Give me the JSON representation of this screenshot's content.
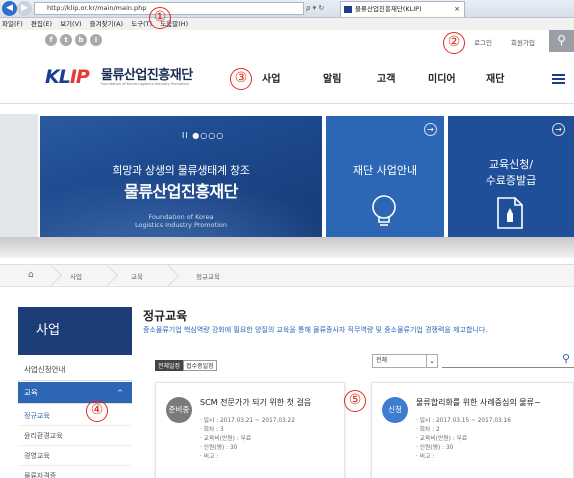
{
  "browser": {
    "url": "http://klip.or.kr/main/main.php",
    "url_tools": "ρ ▾ ↻",
    "tab_title": "물류산업진흥재단(KLIP)",
    "tab_close": "×",
    "menu": [
      "파일(F)",
      "편집(E)",
      "보기(V)",
      "즐겨찾기(A)",
      "도구(T)",
      "도움말(H)"
    ]
  },
  "site": {
    "sns": [
      "f",
      "t",
      "b",
      "i"
    ],
    "login": "로그인",
    "join": "회원가입",
    "search_glyph": "⚲",
    "logo_main": "KL",
    "logo_accent": "IP",
    "name": "물류산업진흥재단",
    "name_sub": "Foundation of Korea Logistics Industry Promotion",
    "gnb": [
      "사업",
      "알림",
      "고객",
      "미디어",
      "재단"
    ]
  },
  "hero": {
    "slider_indicator": "II ●○○○",
    "copy1": "희망과 상생의 물류생태계 창조",
    "copy2": "물류산업진흥재단",
    "sub1": "Foundation of Korea",
    "sub2": "Logistics Industry Promotion",
    "card1_title": "재단 사업안내",
    "card2_title_1": "교육신청/",
    "card2_title_2": "수료증발급",
    "arrow": "→"
  },
  "breadcrumb": {
    "home": "⌂",
    "items": [
      "사업",
      "교육",
      "정규교육"
    ]
  },
  "lnb": {
    "title": "사업",
    "items": [
      "사업신청안내",
      "교육"
    ],
    "caret": "^",
    "sub": [
      "정규교육",
      "윤리환경교육",
      "경영교육",
      "물류자격증"
    ]
  },
  "content": {
    "title": "정규교육",
    "desc": "중소물류기업 핵심역량 강화에 필요한 양질의 교육을 통해 물류종사자 직무역량 및 중소물류기업 경쟁력을 제고합니다.",
    "tabs": [
      "전체일정",
      "접수중일정"
    ],
    "select_value": "전체",
    "select_arrow": "⌄",
    "search_glyph": "⚲"
  },
  "courses": [
    {
      "badge": "준비중",
      "title": "SCM 전문가가 되기 위한 첫 걸음",
      "period": "· 일시 : 2017.03.21 ~ 2017.03.22",
      "count": "· 회차 : 3",
      "fee": "· 교육비(만원) : 무료",
      "capacity": "· 인원(명) : 30",
      "note": "· 비고 :"
    },
    {
      "badge": "신청",
      "title": "물류합리화를 위한 사례중심의 물류~",
      "period": "· 일시 : 2017.03.15 ~ 2017.03.16",
      "count": "· 회차 : 2",
      "fee": "· 교육비(만원) : 무료",
      "capacity": "· 인원(명) : 30",
      "note": "· 비고 :"
    }
  ],
  "annotations": [
    "①",
    "②",
    "③",
    "④",
    "⑤"
  ],
  "colors": {
    "accent": "#e1291a",
    "navy": "#1d3d78",
    "blue": "#2e66b6"
  }
}
